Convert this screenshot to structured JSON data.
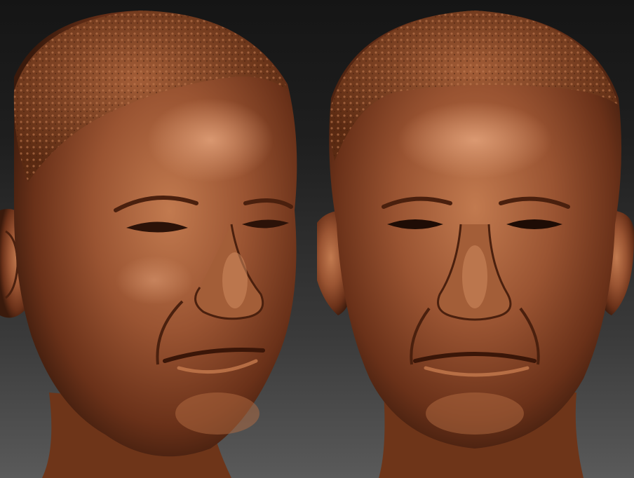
{
  "scene": {
    "background_top": "#151515",
    "background_bottom": "#5a5a5a",
    "material_base": "#8a4a2a",
    "material_light": "#c57a4e",
    "material_dark": "#3a1a0c"
  },
  "views": [
    {
      "name": "three-quarter-view",
      "icon": "sculpted-head-icon"
    },
    {
      "name": "front-view",
      "icon": "sculpted-head-icon"
    }
  ]
}
